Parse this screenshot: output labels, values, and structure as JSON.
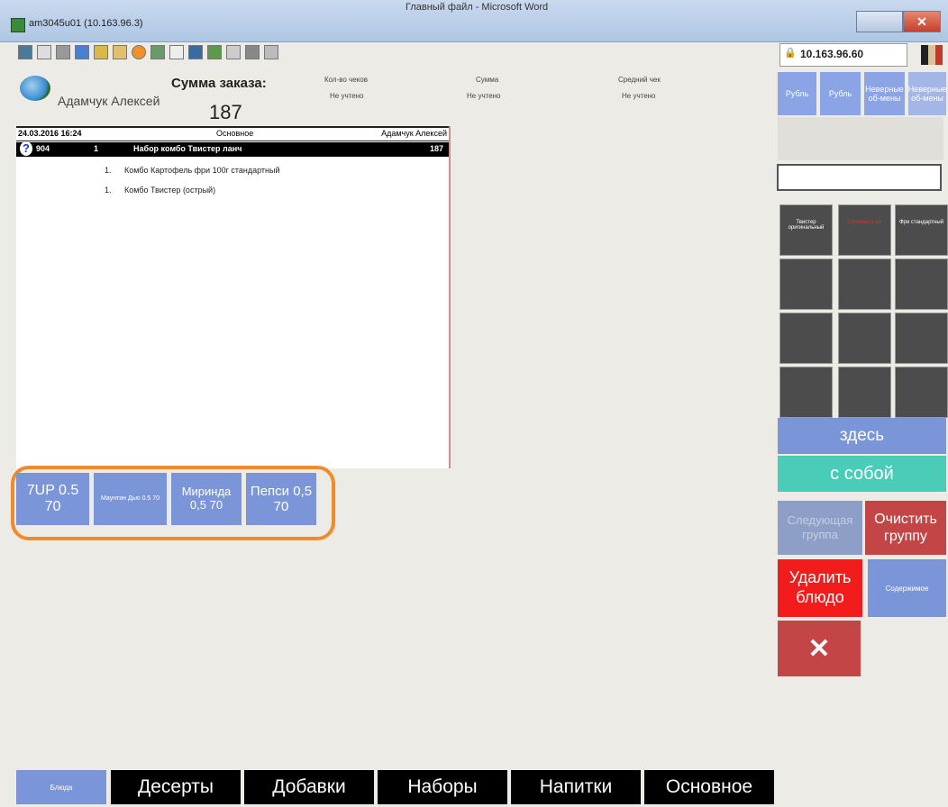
{
  "window": {
    "title": "am3045u01 (10.163.96.3)",
    "doc_title": "Главный файл - Microsoft Word",
    "close_label": "✕"
  },
  "toolbar": {
    "ip": "10.163.96.60",
    "lock_icon": "lock-icon"
  },
  "header": {
    "waiter": "Адамчук Алексей",
    "sum_label": "Сумма заказа:",
    "sum_value": "187",
    "col1_title": "Кол-во чеков",
    "col1_value": "Не учтено",
    "col2_title": "Сумма",
    "col2_value": "Не учтено",
    "col3_title": "Средний чек",
    "col3_value": "Не учтено"
  },
  "order": {
    "date": "24.03.2016 16:24",
    "type": "Основное",
    "waiter": "Адамчук Алексей",
    "selected": {
      "code": "904",
      "qty": "1",
      "name": "Набор комбо Твистер ланч",
      "price": "187"
    },
    "subitems": [
      {
        "qty": "1.",
        "name": "Комбо Картофель фри 100г стандартный"
      },
      {
        "qty": "1.",
        "name": "Комбо Твистер (острый)"
      }
    ]
  },
  "quick_buttons": [
    "7UP 0.5 70",
    "Маунтин Дью 0.5 70",
    "Миринда 0,5 70",
    "Пепси 0,5 70"
  ],
  "right_panel": {
    "top_buttons": [
      "Рубль",
      "Рубль",
      "Неверные об-мены",
      "Неверные об-мены"
    ],
    "cells": [
      "Твистер оригинальный",
      "Стрипсы 3 шт",
      "Фри стандартный"
    ],
    "here": "здесь",
    "takeaway": "с собой",
    "next_group": "Следующая группа",
    "clear_group": "Очистить группу",
    "delete_dish": "Удалить блюдо",
    "contents": "Содержимое",
    "close_x": "✕"
  },
  "tabs": [
    "Блюда",
    "Десерты",
    "Добавки",
    "Наборы",
    "Напитки",
    "Основное"
  ],
  "colors": {
    "accent": "#7b96d8",
    "takeaway": "#49cdb9",
    "danger": "#f21c1c",
    "highlight": "#f08a2a"
  }
}
